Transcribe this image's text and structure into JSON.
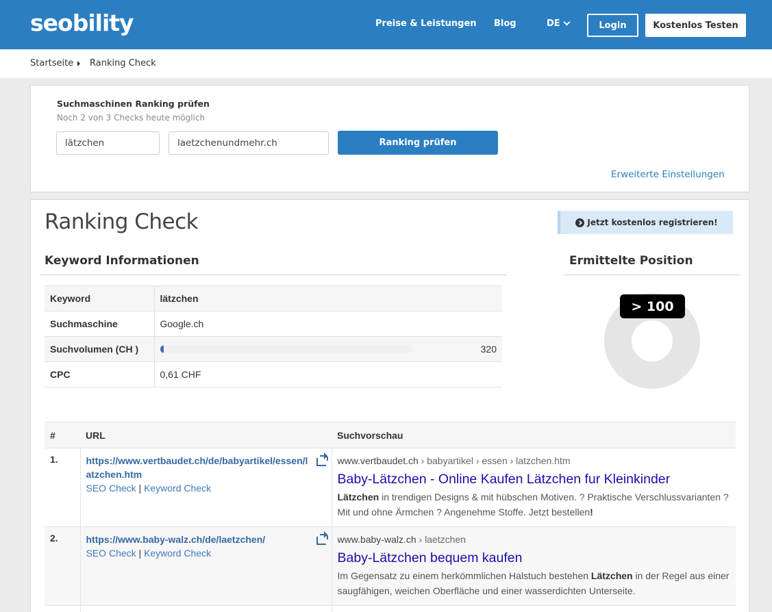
{
  "header": {
    "logo": "seobility",
    "nav": {
      "preise": "Preise & Leistungen",
      "blog": "Blog",
      "lang": "DE"
    },
    "login": "Login",
    "test": "Kostenlos Testen",
    "bg_color": "#2b7ec1"
  },
  "breadcrumb": {
    "home": "Startseite",
    "current": "Ranking Check"
  },
  "search": {
    "title": "Suchmaschinen Ranking prüfen",
    "subtitle": "Noch 2 von 3 Checks heute möglich",
    "keyword": "lätzchen",
    "domain": "laetzchenundmehr.ch",
    "button": "Ranking prüfen",
    "advanced": "Erweiterte Einstellungen"
  },
  "main": {
    "title": "Ranking Check",
    "register": "Jetzt kostenlos registrieren!",
    "kw_heading": "Keyword Informationen",
    "pos_heading": "Ermittelte Position",
    "position": "> 100"
  },
  "keyword_info": {
    "keyword_label": "Keyword",
    "keyword_value": "lätzchen",
    "engine_label": "Suchmaschine",
    "engine_value": "Google.ch",
    "volume_label": "Suchvolumen (CH )",
    "volume_value": "320",
    "volume_fill": 0.015,
    "cpc_label": "CPC",
    "cpc_value": "0,61 CHF"
  },
  "results": {
    "headers": {
      "num": "#",
      "url": "URL",
      "preview": "Suchvorschau"
    },
    "seo_check": "SEO Check",
    "sep": "|",
    "keyword_check": "Keyword Check",
    "rows": [
      {
        "num": "1.",
        "url": "https://www.vertbaudet.ch/de/babyartikel/essen/latzchen.htm",
        "domain": "www.vertbaudet.ch",
        "path": " › babyartikel › essen › latzchen.htm",
        "title": "Baby-Lätzchen - Online Kaufen Lätzchen fur Kleinkinder",
        "desc_bold": "Lätzchen",
        "desc_rest": " in trendigen Designs & mit hübschen Motiven. ? Praktische Verschlussvarianten ? Mit und ohne Ärmchen ? Angenehme Stoffe. Jetzt bestellen",
        "desc_end": "!"
      },
      {
        "num": "2.",
        "url": "https://www.baby-walz.ch/de/laetzchen/",
        "domain": "www.baby-walz.ch",
        "path": " › laetzchen",
        "title": "Baby-Lätzchen bequem kaufen",
        "desc_pre": "Im Gegensatz zu einem herkömmlichen Halstuch bestehen ",
        "desc_bold": "Lätzchen",
        "desc_rest": " in der Regel aus einer saugfähigen, weichen Oberfläche und einer wasserdichten Unterseite."
      }
    ]
  }
}
